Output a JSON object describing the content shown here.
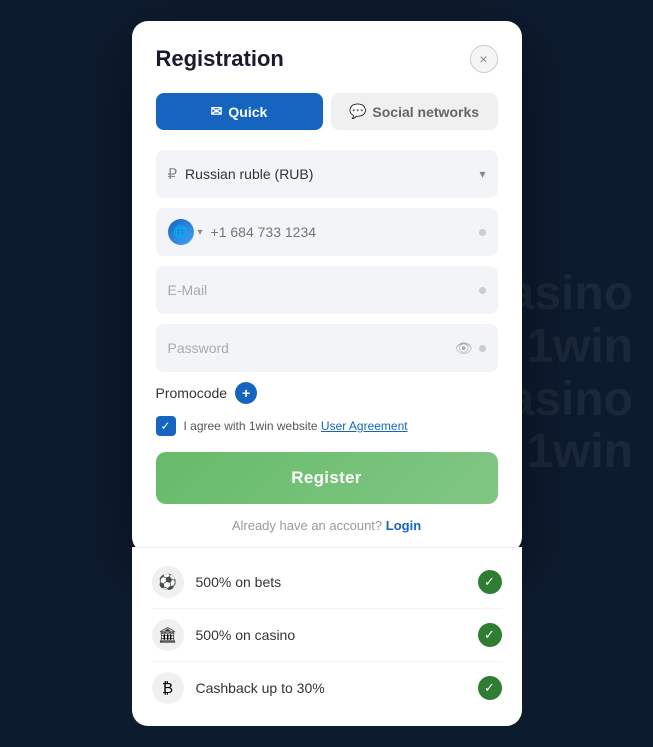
{
  "background": {
    "lines": [
      "Casino",
      "1win",
      "Casino",
      "1win"
    ]
  },
  "modal": {
    "title": "Registration",
    "close_label": "×",
    "tabs": [
      {
        "id": "quick",
        "label": "Quick",
        "active": true,
        "icon": "✉"
      },
      {
        "id": "social",
        "label": "Social networks",
        "active": false,
        "icon": "💬"
      }
    ],
    "currency": {
      "value": "Russian ruble (RUB)",
      "icon": "₽"
    },
    "phone": {
      "placeholder": "+1 684 733 1234",
      "flag_text": ""
    },
    "email": {
      "placeholder": "E-Mail"
    },
    "password": {
      "placeholder": "Password"
    },
    "promocode": {
      "label": "Promocode",
      "plus": "+"
    },
    "agreement": {
      "text": "I agree with 1win website ",
      "link_text": "User Agreement"
    },
    "register_btn": "Register",
    "login_text": "Already have an account?",
    "login_link": "Login"
  },
  "bonuses": [
    {
      "icon": "⚽",
      "text": "500% on bets"
    },
    {
      "icon": "🏛",
      "text": "500% on casino"
    },
    {
      "icon": "₿",
      "text": "Cashback up to 30%"
    }
  ]
}
